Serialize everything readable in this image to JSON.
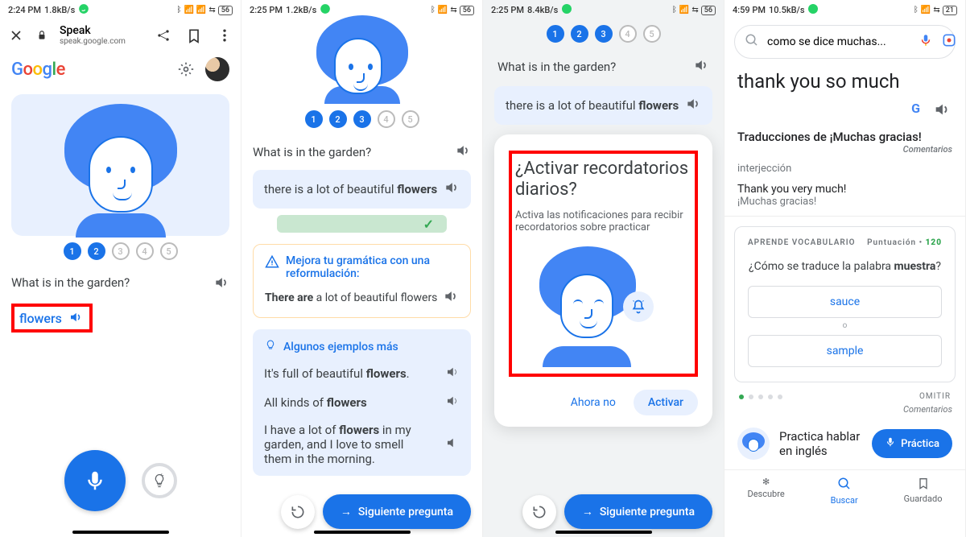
{
  "s1": {
    "status": {
      "time": "2:24 PM",
      "net": "1.8kB/s",
      "bat": "56",
      "wa": "📶"
    },
    "addr": {
      "title": "Speak",
      "sub": "speak.google.com"
    },
    "dots": [
      "1",
      "2",
      "3",
      "4",
      "5"
    ],
    "question": "What is in the garden?",
    "answer": "flowers"
  },
  "s2": {
    "status": {
      "time": "2:25 PM",
      "net": "1.2kB/s",
      "bat": "56"
    },
    "dots": [
      "1",
      "2",
      "3",
      "4",
      "5"
    ],
    "question": "What is in the garden?",
    "user_prefix": "there is a lot of beautiful ",
    "user_bold": "flowers",
    "tip_h": "Mejora tu gramática con una reformulación:",
    "tip_bold": "There are",
    "tip_rest": " a lot of beautiful flowers",
    "ex_h": "Algunos ejemplos más",
    "ex1_a": "It's full of beautiful ",
    "ex1_b": "flowers",
    "ex1_c": ".",
    "ex2_a": "All kinds of ",
    "ex2_b": "flowers",
    "ex3_a": "I have a lot of ",
    "ex3_b": "flowers",
    "ex3_c": " in my garden, and I love to smell them in the morning.",
    "next": "Siguiente pregunta"
  },
  "s3": {
    "status": {
      "time": "2:25 PM",
      "net": "8.4kB/s",
      "bat": "56"
    },
    "dots": [
      "1",
      "2",
      "3",
      "4",
      "5"
    ],
    "question": "What is in the garden?",
    "user_prefix": "there is a lot of beautiful ",
    "user_bold": "flowers",
    "modal_h": "¿Activar recordatorios diarios?",
    "modal_p": "Activa las notificaciones para recibir recordatorios sobre practicar",
    "no": "Ahora no",
    "yes": "Activar",
    "next": "Siguiente pregunta"
  },
  "s4": {
    "status": {
      "time": "4:59 PM",
      "net": "10.5kB/s",
      "bat": "21"
    },
    "search": "como se dice muchas...",
    "big": "thank you so much",
    "sect": "Traducciones de ¡Muchas gracias!",
    "comment": "Comentarios",
    "itj": "interjección",
    "tr1": "Thank you very much!",
    "tr2": "¡Muchas gracias!",
    "vocab_h": "APRENDE VOCABULARIO",
    "score_l": "Puntuación",
    "score_v": "120",
    "vq_a": "¿Cómo se traduce la palabra ",
    "vq_b": "muestra",
    "vq_c": "?",
    "opt1": "sauce",
    "sep": "o",
    "opt2": "sample",
    "skip": "OMITIR",
    "pr_t": "Practica hablar",
    "pr_s": "en inglés",
    "pr_b": "Práctica",
    "nav1": "Descubre",
    "nav2": "Buscar",
    "nav3": "Guardado"
  }
}
